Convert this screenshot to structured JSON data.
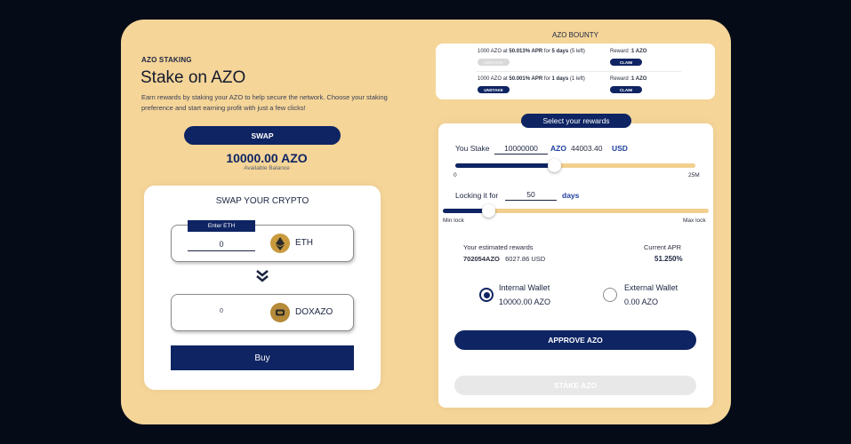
{
  "colors": {
    "background": "#060b18",
    "card": "#f5d598",
    "primary": "#0e2463",
    "track": "#f2cf8e",
    "accent_text": "#1f3fa0"
  },
  "left": {
    "eyebrow": "AZO STAKING",
    "title": "Stake on AZO",
    "description": "Earn rewards by staking your AZO to help secure the network. Choose your staking preference and start earning profit with just a few clicks!",
    "swap_button": "SWAP",
    "balance": "10000.00 AZO",
    "balance_label": "Available Balance"
  },
  "swap": {
    "title": "SWAP YOUR CRYPTO",
    "input_label": "Enter ETH",
    "from_amount": "0",
    "from_token": "ETH",
    "from_icon": "ethereum-icon",
    "to_amount": "0",
    "to_token": "DOXAZO",
    "to_icon": "doxazo-coin-icon",
    "arrow_icon": "double-chevron-down-icon",
    "buy_button": "Buy"
  },
  "bounty": {
    "title": "AZO BOUNTY",
    "rows": [
      {
        "amount": "1000 AZO at",
        "apr": "50.013% APR",
        "for": "for",
        "days": "5 days",
        "left": "(5 left)",
        "unstake": "UNSTAKE",
        "unstake_disabled": true,
        "reward_label": "Reward :",
        "reward_value": "1 AZO",
        "claim": "CLAIM"
      },
      {
        "amount": "1000 AZO at",
        "apr": "50.001% APR",
        "for": "for",
        "days": "1 days",
        "left": "(1 left)",
        "unstake": "UNSTAKE",
        "unstake_disabled": false,
        "reward_label": "Reward :",
        "reward_value": "1 AZO",
        "claim": "CLAIM"
      }
    ]
  },
  "rewards": {
    "pill": "Select your rewards",
    "stake_label": "You Stake",
    "stake_value": "10000000",
    "stake_unit": "AZO",
    "stake_usd": "44003.40",
    "stake_usd_unit": "USD",
    "stake_slider": 0.41,
    "stake_min": "0",
    "stake_max": "25M",
    "lock_label": "Locking it for",
    "lock_value": "50",
    "lock_unit": "days",
    "lock_slider": 0.17,
    "lock_min": "Min lock",
    "lock_max": "Max lock",
    "est_label": "Your estimated rewards",
    "est_azo": "702054AZO",
    "est_usd": "6027.86 USD",
    "apr_label": "Current APR",
    "apr_value": "51.250%",
    "wallets": [
      {
        "name": "Internal Wallet",
        "balance": "10000.00 AZO",
        "selected": true
      },
      {
        "name": "External Wallet",
        "balance": "0.00 AZO",
        "selected": false
      }
    ],
    "approve_button": "APPROVE AZO",
    "stake_button": "STAKE AZO"
  }
}
